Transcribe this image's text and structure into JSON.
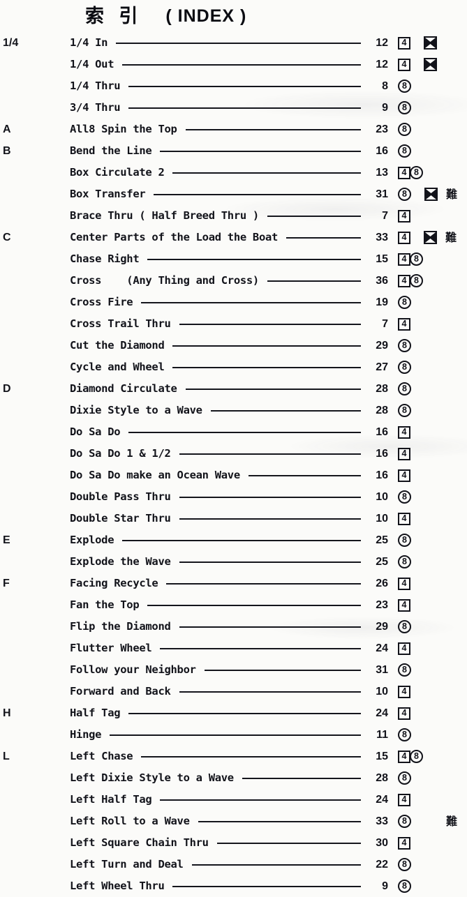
{
  "title": {
    "cjk": "索 引",
    "latin": "( INDEX )"
  },
  "badge_glyphs": {
    "four": "4",
    "eight": "8",
    "hard": "難"
  },
  "colors": {
    "ink": "#12131a",
    "paper": "#fbfbf9"
  },
  "rows": [
    {
      "letter": "1/4",
      "name": "1/4 In",
      "page": "12",
      "badges": [
        "4",
        "X"
      ]
    },
    {
      "letter": "",
      "name": "1/4 Out",
      "page": "12",
      "badges": [
        "4",
        "X"
      ]
    },
    {
      "letter": "",
      "name": "1/4 Thru",
      "page": "8",
      "badges": [
        "8"
      ]
    },
    {
      "letter": "",
      "name": "3/4 Thru",
      "page": "9",
      "badges": [
        "8"
      ]
    },
    {
      "letter": "A",
      "name": "All8 Spin the Top",
      "page": "23",
      "badges": [
        "8"
      ]
    },
    {
      "letter": "B",
      "name": "Bend the Line",
      "page": "16",
      "badges": [
        "8"
      ]
    },
    {
      "letter": "",
      "name": "Box Circulate 2",
      "page": "13",
      "badges": [
        "4",
        "8"
      ]
    },
    {
      "letter": "",
      "name": "Box Transfer",
      "page": "31",
      "badges": [
        "8",
        "X",
        "難"
      ]
    },
    {
      "letter": "",
      "name": "Brace Thru ( Half Breed Thru )",
      "page": "7",
      "badges": [
        "4"
      ]
    },
    {
      "letter": "C",
      "name": "Center Parts of the Load the Boat",
      "page": "33",
      "badges": [
        "4",
        "X",
        "難"
      ]
    },
    {
      "letter": "",
      "name": "Chase Right",
      "page": "15",
      "badges": [
        "4",
        "8"
      ]
    },
    {
      "letter": "",
      "name": "Cross    (Any Thing and Cross)",
      "page": "36",
      "badges": [
        "4",
        "8"
      ]
    },
    {
      "letter": "",
      "name": "Cross Fire",
      "page": "19",
      "badges": [
        "8"
      ]
    },
    {
      "letter": "",
      "name": "Cross Trail Thru",
      "page": "7",
      "badges": [
        "4"
      ]
    },
    {
      "letter": "",
      "name": "Cut the Diamond",
      "page": "29",
      "badges": [
        "8"
      ]
    },
    {
      "letter": "",
      "name": "Cycle and Wheel",
      "page": "27",
      "badges": [
        "8"
      ]
    },
    {
      "letter": "D",
      "name": "Diamond Circulate",
      "page": "28",
      "badges": [
        "8"
      ]
    },
    {
      "letter": "",
      "name": "Dixie Style to a Wave",
      "page": "28",
      "badges": [
        "8"
      ]
    },
    {
      "letter": "",
      "name": "Do Sa Do",
      "page": "16",
      "badges": [
        "4"
      ]
    },
    {
      "letter": "",
      "name": "Do Sa Do 1 & 1/2",
      "page": "16",
      "badges": [
        "4"
      ]
    },
    {
      "letter": "",
      "name": "Do Sa Do make an Ocean Wave",
      "page": "16",
      "badges": [
        "4"
      ]
    },
    {
      "letter": "",
      "name": "Double Pass Thru",
      "page": "10",
      "badges": [
        "8"
      ]
    },
    {
      "letter": "",
      "name": "Double Star Thru",
      "page": "10",
      "badges": [
        "4"
      ]
    },
    {
      "letter": "E",
      "name": "Explode",
      "page": "25",
      "badges": [
        "8"
      ]
    },
    {
      "letter": "",
      "name": "Explode the Wave",
      "page": "25",
      "badges": [
        "8"
      ]
    },
    {
      "letter": "F",
      "name": "Facing Recycle",
      "page": "26",
      "badges": [
        "4"
      ]
    },
    {
      "letter": "",
      "name": "Fan the Top",
      "page": "23",
      "badges": [
        "4"
      ]
    },
    {
      "letter": "",
      "name": "Flip the Diamond",
      "page": "29",
      "badges": [
        "8"
      ]
    },
    {
      "letter": "",
      "name": "Flutter Wheel",
      "page": "24",
      "badges": [
        "4"
      ]
    },
    {
      "letter": "",
      "name": "Follow your Neighbor",
      "page": "31",
      "badges": [
        "8"
      ]
    },
    {
      "letter": "",
      "name": "Forward and Back",
      "page": "10",
      "badges": [
        "4"
      ]
    },
    {
      "letter": "H",
      "name": "Half Tag",
      "page": "24",
      "badges": [
        "4"
      ]
    },
    {
      "letter": "",
      "name": "Hinge",
      "page": "11",
      "badges": [
        "8"
      ]
    },
    {
      "letter": "L",
      "name": "Left Chase",
      "page": "15",
      "badges": [
        "4",
        "8"
      ]
    },
    {
      "letter": "",
      "name": "Left Dixie Style to a Wave",
      "page": "28",
      "badges": [
        "8"
      ]
    },
    {
      "letter": "",
      "name": "Left Half Tag",
      "page": "24",
      "badges": [
        "4"
      ]
    },
    {
      "letter": "",
      "name": "Left Roll to a Wave",
      "page": "33",
      "badges": [
        "8",
        "難"
      ]
    },
    {
      "letter": "",
      "name": "Left Square Chain Thru",
      "page": "30",
      "badges": [
        "4"
      ]
    },
    {
      "letter": "",
      "name": "Left Turn and Deal",
      "page": "22",
      "badges": [
        "8"
      ]
    },
    {
      "letter": "",
      "name": "Left Wheel Thru",
      "page": "9",
      "badges": [
        "8"
      ]
    }
  ]
}
